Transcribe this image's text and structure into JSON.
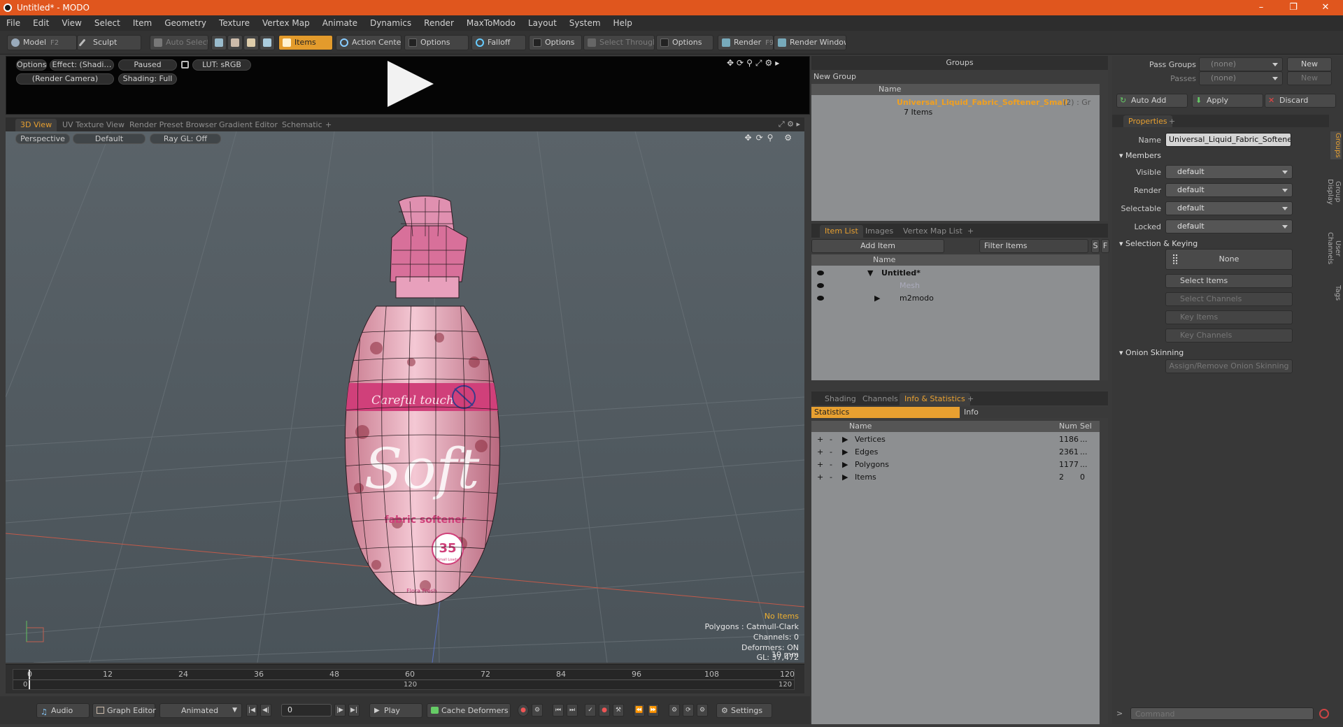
{
  "window": {
    "title": "Untitled* - MODO",
    "minimize": "–",
    "maximize": "❐",
    "close": "✕"
  },
  "menu": [
    "File",
    "Edit",
    "View",
    "Select",
    "Item",
    "Geometry",
    "Texture",
    "Vertex Map",
    "Animate",
    "Dynamics",
    "Render",
    "MaxToModo",
    "Layout",
    "System",
    "Help"
  ],
  "toolbar": {
    "model": "Model",
    "model_key": "F2",
    "sculpt": "Sculpt",
    "auto_select": "Auto Select",
    "items": "Items",
    "action_center": "Action Center",
    "options1": "Options",
    "falloff": "Falloff",
    "options2": "Options",
    "select_through": "Select Through",
    "options3": "Options",
    "render": "Render",
    "render_key": "F9",
    "render_window": "Render Window"
  },
  "preview": {
    "options": "Options",
    "effect": "Effect: (Shadi…",
    "paused": "Paused",
    "lut": "LUT: sRGB",
    "camera": "(Render Camera)",
    "shading": "Shading: Full"
  },
  "viewport_tabs": [
    "3D View",
    "UV Texture View",
    "Render Preset Browser",
    "Gradient Editor",
    "Schematic",
    "+"
  ],
  "viewport": {
    "perspective": "Perspective",
    "default": "Default",
    "raygl": "Ray GL: Off",
    "hud": {
      "no_items": "No Items",
      "polygons": "Polygons : Catmull-Clark",
      "channels": "Channels: 0",
      "deformers": "Deformers: ON",
      "gl": "GL: 37,472",
      "scale": "10 mm"
    }
  },
  "product": {
    "brand": "Careful touch",
    "logo": "Soft",
    "type": "fabric softener",
    "loads": "35",
    "loads_sub": "Small Loads",
    "bottom": "Flora Fresh"
  },
  "timeline": {
    "ticks": [
      "0",
      "12",
      "24",
      "36",
      "48",
      "60",
      "72",
      "84",
      "96",
      "108",
      "120"
    ],
    "sub": [
      "0",
      "120",
      "120"
    ]
  },
  "bottom": {
    "audio": "Audio",
    "graph_editor": "Graph Editor",
    "animated": "Animated",
    "frame": "0",
    "play": "Play",
    "cache_deformers": "Cache Deformers",
    "settings": "Settings"
  },
  "groups": {
    "title": "Groups",
    "new_group": "New Group",
    "col_name": "Name",
    "item_name": "Universal_Liquid_Fabric_Softener_Small",
    "item_count": "(2) : Gr",
    "item_sub": "7 Items"
  },
  "item_list": {
    "tabs": [
      "Item List",
      "Images",
      "Vertex Map List",
      "+"
    ],
    "add_item": "Add Item",
    "filter": "Filter Items",
    "s": "S",
    "f": "F",
    "col_name": "Name",
    "rows": [
      {
        "name": "Untitled*",
        "indent": 0
      },
      {
        "name": "Mesh",
        "indent": 1
      },
      {
        "name": "m2modo",
        "indent": 1
      }
    ]
  },
  "stats": {
    "tabs": [
      "Shading",
      "Channels",
      "Info & Statistics",
      "+"
    ],
    "sub_tabs": [
      "Statistics",
      "Info"
    ],
    "cols": [
      "Name",
      "Num",
      "Sel"
    ],
    "rows": [
      {
        "name": "Vertices",
        "num": "1186",
        "sel": "..."
      },
      {
        "name": "Edges",
        "num": "2361",
        "sel": "..."
      },
      {
        "name": "Polygons",
        "num": "1177",
        "sel": "..."
      },
      {
        "name": "Items",
        "num": "2",
        "sel": "0"
      }
    ]
  },
  "passes": {
    "pass_groups": "Pass Groups",
    "passes": "Passes",
    "none": "(none)",
    "new": "New"
  },
  "actions": {
    "auto_add": "Auto Add",
    "apply": "Apply",
    "discard": "Discard"
  },
  "properties": {
    "tab": "Properties",
    "plus": "+",
    "name_label": "Name",
    "name_value": "Universal_Liquid_Fabric_Softener_Si",
    "members": "Members",
    "fields": [
      {
        "label": "Visible",
        "value": "default"
      },
      {
        "label": "Render",
        "value": "default"
      },
      {
        "label": "Selectable",
        "value": "default"
      },
      {
        "label": "Locked",
        "value": "default"
      }
    ],
    "sel_keying": "Selection & Keying",
    "none": "None",
    "select_items": "Select Items",
    "select_channels": "Select Channels",
    "key_items": "Key Items",
    "key_channels": "Key Channels",
    "onion": "Onion Skinning",
    "assign_onion": "Assign/Remove Onion Skinning",
    "vtabs": [
      "Groups",
      "Group Display",
      "User Channels",
      "Tags"
    ]
  },
  "command": {
    "placeholder": "Command"
  }
}
